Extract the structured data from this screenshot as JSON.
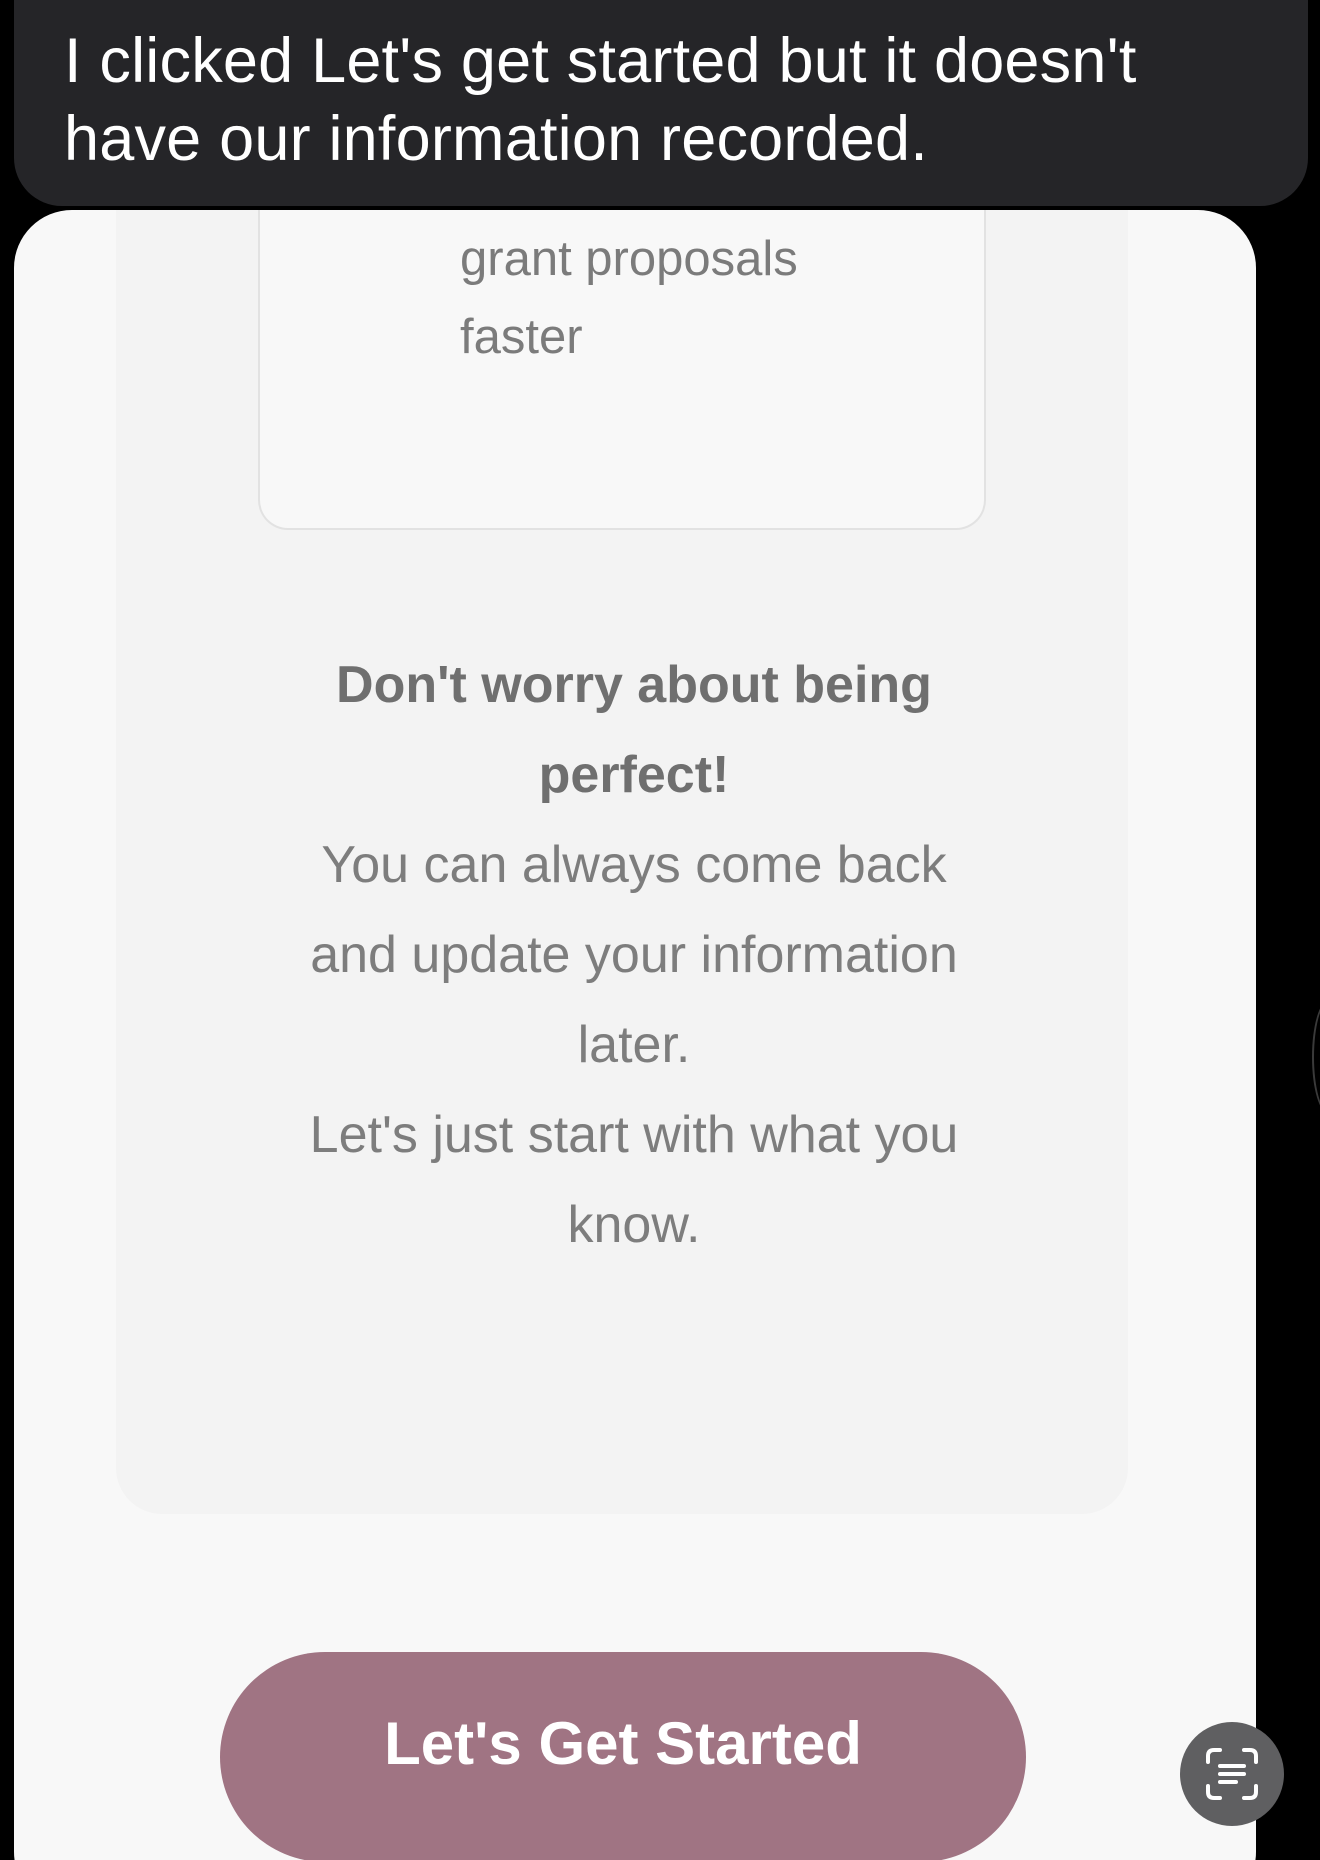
{
  "message": {
    "text": "I clicked Let's get started but it doesn't have our information recorded."
  },
  "screenshot": {
    "feature_card": {
      "text": "create compelling grant proposals faster"
    },
    "reassurance": {
      "heading": "Don't worry about being perfect!",
      "line1": "You can always come back and update your information later.",
      "line2": "Let's just start with what you know."
    },
    "cta": {
      "label": "Let's Get Started",
      "color": "#a07483"
    }
  },
  "overlay": {
    "scan_icon": "live-text-scan-icon"
  }
}
